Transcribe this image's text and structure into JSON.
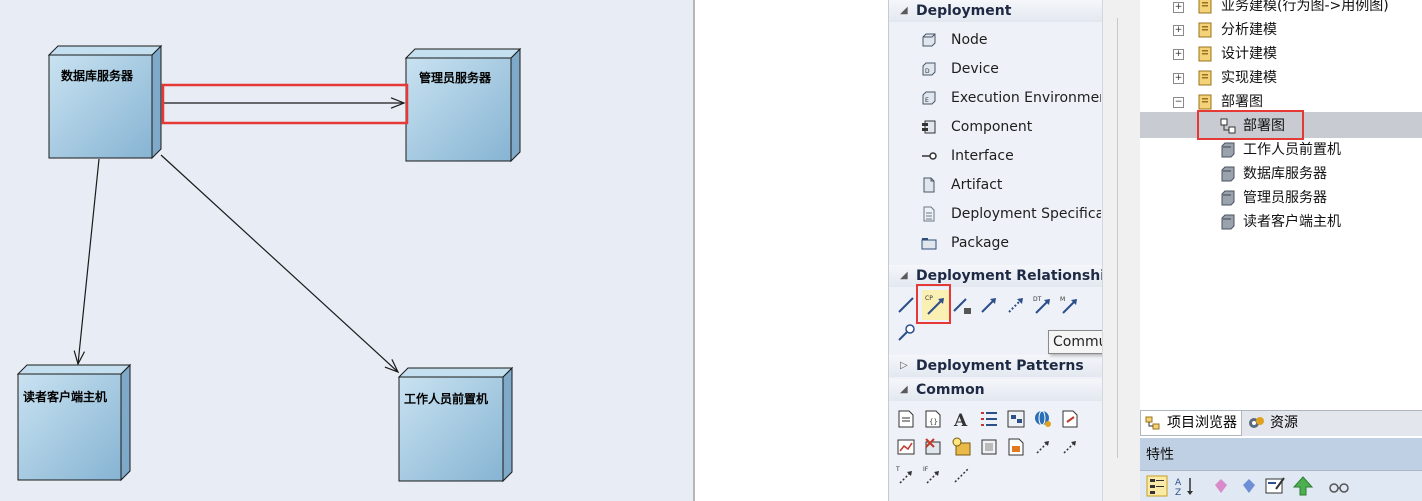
{
  "diagram": {
    "nodes": [
      {
        "id": "db",
        "label": "数据库服务器"
      },
      {
        "id": "admin",
        "label": "管理员服务器"
      },
      {
        "id": "reader",
        "label": "读者客户端主机"
      },
      {
        "id": "staff",
        "label": "工作人员前置机"
      }
    ],
    "links": [
      {
        "from": "db",
        "to": "admin",
        "highlighted": true
      },
      {
        "from": "db",
        "to": "reader"
      },
      {
        "from": "db",
        "to": "staff"
      }
    ],
    "colors": {
      "node_fill": "#a9cde4",
      "node_side": "#7ea9c8",
      "highlight": "#e53935",
      "canvas": "#e8ecf4"
    }
  },
  "toolbox": {
    "deployment": {
      "header": "Deployment",
      "items": [
        {
          "label": "Node",
          "icon": "node-icon"
        },
        {
          "label": "Device",
          "icon": "device-icon"
        },
        {
          "label": "Execution Environmen",
          "icon": "execution-environment-icon"
        },
        {
          "label": "Component",
          "icon": "component-icon"
        },
        {
          "label": "Interface",
          "icon": "interface-icon"
        },
        {
          "label": "Artifact",
          "icon": "artifact-icon"
        },
        {
          "label": "Deployment Specifica",
          "icon": "deployment-spec-icon"
        },
        {
          "label": "Package",
          "icon": "package-icon"
        }
      ]
    },
    "relationships": {
      "header": "Deployment Relationships",
      "tooltip": "Communication Path"
    },
    "patterns": {
      "header": "Deployment Patterns"
    },
    "common": {
      "header": "Common"
    }
  },
  "browser": {
    "items": [
      {
        "label": "业务建模(行为图->用例图)",
        "expander": "+"
      },
      {
        "label": "分析建模",
        "expander": "+"
      },
      {
        "label": "设计建模",
        "expander": "+"
      },
      {
        "label": "实现建模",
        "expander": "+"
      },
      {
        "label": "部署图",
        "expander": "−"
      }
    ],
    "children": [
      {
        "label": "部署图",
        "selected": true
      },
      {
        "label": "工作人员前置机"
      },
      {
        "label": "数据库服务器"
      },
      {
        "label": "管理员服务器"
      },
      {
        "label": "读者客户端主机"
      }
    ],
    "tabs": [
      {
        "label": "项目浏览器"
      },
      {
        "label": "资源"
      }
    ],
    "properties_title": "特性"
  }
}
